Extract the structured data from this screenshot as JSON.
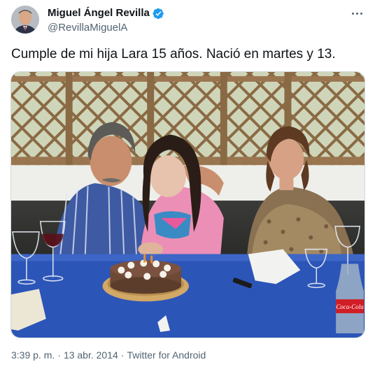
{
  "author": {
    "display_name": "Miguel Ángel Revilla",
    "handle": "@RevillaMiguelA",
    "verified": true,
    "verified_color": "#1d9bf0"
  },
  "tweet": {
    "text": "Cumple de mi hija Lara 15 años. Nació en martes y 13."
  },
  "meta": {
    "time": "3:39 p. m.",
    "date": "13 abr. 2014",
    "separator": "·",
    "source": "Twitter for Android"
  },
  "photo": {
    "bottle_label": "Coca-Cola"
  },
  "icons": {
    "verified": "verified-badge-icon",
    "more": "more-options-icon"
  },
  "colors": {
    "text": "#0f1419",
    "secondary": "#536471",
    "tablecloth": "#2c55b8"
  }
}
